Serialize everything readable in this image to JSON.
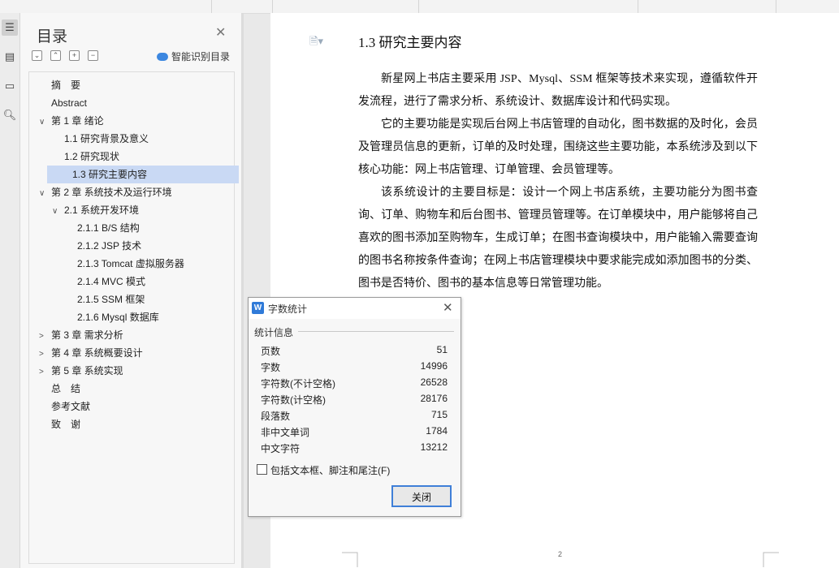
{
  "toc": {
    "title": "目录",
    "smart_label": "智能识别目录",
    "items": [
      {
        "label": "摘　要",
        "level": 0,
        "arrow": "",
        "selected": false
      },
      {
        "label": "Abstract",
        "level": 0,
        "arrow": "",
        "selected": false
      },
      {
        "label": "第 1 章  绪论",
        "level": 0,
        "arrow": "∨",
        "selected": false
      },
      {
        "label": "1.1  研究背景及意义",
        "level": 1,
        "arrow": "",
        "selected": false
      },
      {
        "label": "1.2  研究现状",
        "level": 1,
        "arrow": "",
        "selected": false
      },
      {
        "label": "1.3  研究主要内容",
        "level": 1,
        "arrow": "",
        "selected": true
      },
      {
        "label": "第 2 章  系统技术及运行环境",
        "level": 0,
        "arrow": "∨",
        "selected": false
      },
      {
        "label": "2.1 系统开发环境",
        "level": 1,
        "arrow": "∨",
        "selected": false
      },
      {
        "label": "2.1.1 B/S 结构",
        "level": 2,
        "arrow": "",
        "selected": false
      },
      {
        "label": "2.1.2 JSP 技术",
        "level": 2,
        "arrow": "",
        "selected": false
      },
      {
        "label": "2.1.3 Tomcat 虚拟服务器",
        "level": 2,
        "arrow": "",
        "selected": false
      },
      {
        "label": "2.1.4 MVC 模式",
        "level": 2,
        "arrow": "",
        "selected": false
      },
      {
        "label": "2.1.5 SSM 框架",
        "level": 2,
        "arrow": "",
        "selected": false
      },
      {
        "label": "2.1.6 Mysql 数据库",
        "level": 2,
        "arrow": "",
        "selected": false
      },
      {
        "label": "第 3 章  需求分析",
        "level": 0,
        "arrow": ">",
        "selected": false
      },
      {
        "label": "第 4 章  系统概要设计",
        "level": 0,
        "arrow": ">",
        "selected": false
      },
      {
        "label": "第 5 章  系统实现",
        "level": 0,
        "arrow": ">",
        "selected": false
      },
      {
        "label": "总　结",
        "level": 0,
        "arrow": "",
        "selected": false
      },
      {
        "label": "参考文献",
        "level": 0,
        "arrow": "",
        "selected": false
      },
      {
        "label": "致　谢",
        "level": 0,
        "arrow": "",
        "selected": false
      }
    ]
  },
  "document": {
    "heading": "1.3  研究主要内容",
    "paragraphs": [
      "新星网上书店主要采用 JSP、Mysql、SSM 框架等技术来实现，遵循软件开发流程，进行了需求分析、系统设计、数据库设计和代码实现。",
      "它的主要功能是实现后台网上书店管理的自动化，图书数据的及时化，会员及管理员信息的更新，订单的及时处理，围绕这些主要功能，本系统涉及到以下核心功能：网上书店管理、订单管理、会员管理等。",
      "该系统设计的主要目标是：设计一个网上书店系统，主要功能分为图书查询、订单、购物车和后台图书、管理员管理等。在订单模块中，用户能够将自己喜欢的图书添加至购物车，生成订单；在图书查询模块中，用户能输入需要查询的图书名称按条件查询；在网上书店管理模块中要求能完成如添加图书的分类、图书是否特价、图书的基本信息等日常管理功能。"
    ],
    "page_number": "2"
  },
  "dialog": {
    "title": "字数统计",
    "group_label": "统计信息",
    "stats": [
      {
        "label": "页数",
        "value": "51"
      },
      {
        "label": "字数",
        "value": "14996"
      },
      {
        "label": "字符数(不计空格)",
        "value": "26528"
      },
      {
        "label": "字符数(计空格)",
        "value": "28176"
      },
      {
        "label": "段落数",
        "value": "715"
      },
      {
        "label": "非中文单词",
        "value": "1784"
      },
      {
        "label": "中文字符",
        "value": "13212"
      }
    ],
    "checkbox_label": "包括文本框、脚注和尾注(F)",
    "checkbox_checked": false,
    "close_label": "关闭"
  },
  "colors": {
    "selection": "#c9d9f4",
    "accent": "#3f7fd8"
  }
}
